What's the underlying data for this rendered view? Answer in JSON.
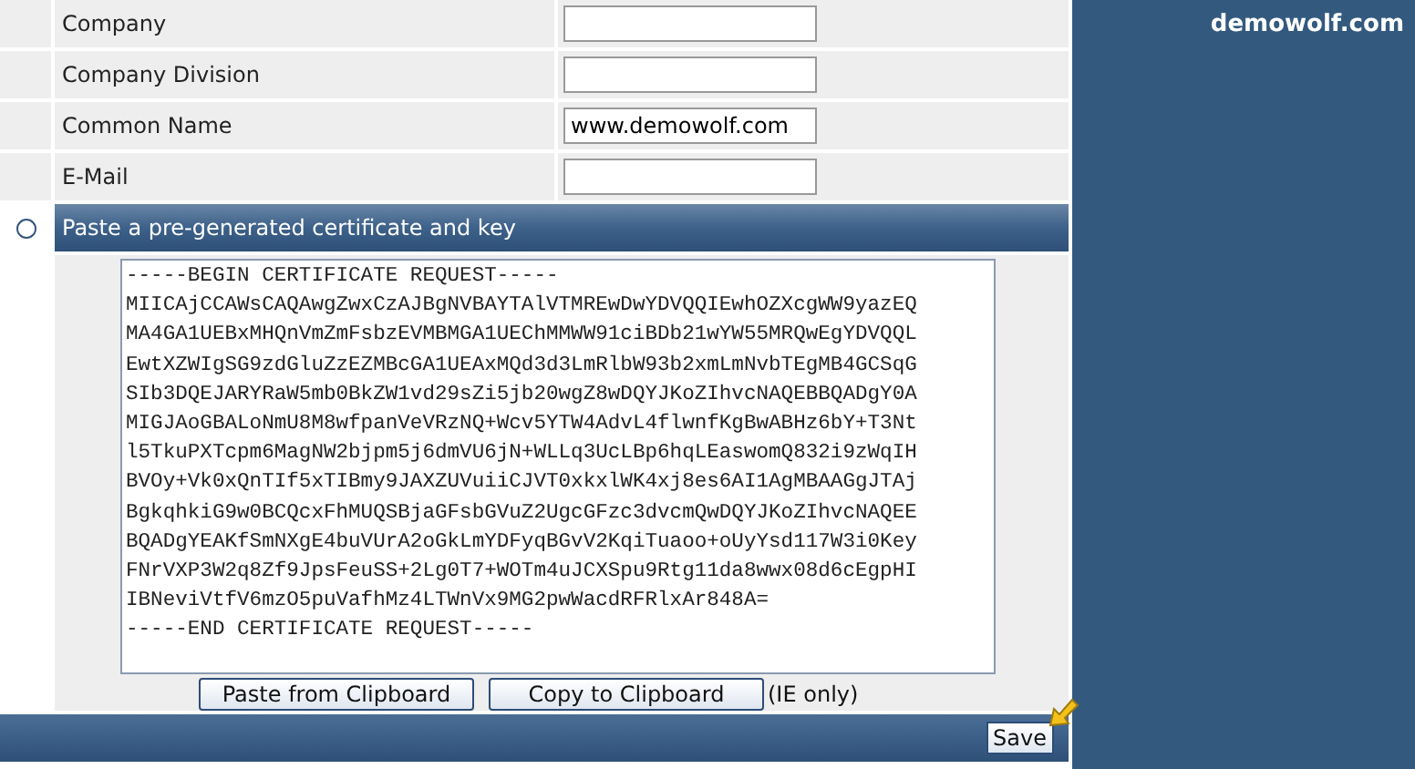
{
  "site": {
    "title": "demowolf.com"
  },
  "fields": [
    {
      "label": "Company"
    },
    {
      "label": "Company Division"
    },
    {
      "label": "Common Name",
      "value": "www.demowolf.com"
    },
    {
      "label": "E-Mail"
    }
  ],
  "option": {
    "label": "Paste a pre-generated certificate and key",
    "selected": false
  },
  "certificate": [
    "-----BEGIN CERTIFICATE REQUEST-----",
    "MIICAjCCAWsCAQAwgZwxCzAJBgNVBAYTAlVTMREwDwYDVQQIEwhOZXcgWW9yazEQ",
    "MA4GA1UEBxMHQnVmZmFsbzEVMBMGA1UEChMMWW91ciBDb21wYW55MRQwEgYDVQQL",
    "EwtXZWIgSG9zdGluZzEZMBcGA1UEAxMQd3d3LmRlbW93b2xmLmNvbTEgMB4GCSqG",
    "SIb3DQEJARYRaW5mb0BkZW1vd29sZi5jb20wgZ8wDQYJKoZIhvcNAQEBBQADgY0A",
    "MIGJAoGBALoNmU8M8wfpanVeVRzNQ+Wcv5YTW4AdvL4flwnfKgBwABHz6bY+T3Nt",
    "l5TkuPXTcpm6MagNW2bjpm5j6dmVU6jN+WLLq3UcLBp6hqLEaswomQ832i9zWqIH",
    "BVOy+Vk0xQnTIf5xTIBmy9JAXZUVuiiCJVT0xkxlWK4xj8es6AI1AgMBAAGgJTAj",
    "BgkqhkiG9w0BCQcxFhMUQSBjaGFsbGVuZ2UgcGFzc3dvcmQwDQYJKoZIhvcNAQEE",
    "BQADgYEAKfSmNXgE4buVUrA2oGkLmYDFyqBGvV2KqiTuaoo+oUyYsd117W3i0Key",
    "FNrVXP3W2q8Zf9JpsFeuSS+2Lg0T7+WOTm4uJCXSpu9Rtg11da8wwx08d6cEgpHI",
    "IBNeviVtfV6mzO5puVafhMz4LTWnVx9MG2pwWacdRFRlxAr848A=",
    "-----END CERTIFICATE REQUEST-----"
  ],
  "buttons": [
    {
      "label": "Paste from Clipboard"
    },
    {
      "label": "Copy to Clipboard"
    }
  ],
  "note": "(IE only)",
  "save": {
    "label": "Save"
  }
}
